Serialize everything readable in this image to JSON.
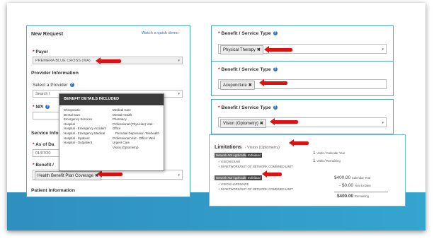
{
  "left_panel": {
    "title": "New Request",
    "demo_link": "Watch a quick demo",
    "payer_label": "Payer",
    "payer_value": "PREMERA BLUE CROSS (WA)",
    "provider_info_heading": "Provider Information",
    "select_provider_label": "Select a Provider",
    "search_placeholder": "Search I",
    "npi_label": "NPI",
    "service_info_heading": "Service Info",
    "as_of_label": "As of Da",
    "date_value": "01/07/20",
    "benefit_label": "Benefit /",
    "benefit_value": "Health Benefit Plan Coverage",
    "patient_info_heading": "Patient Information"
  },
  "popup": {
    "title": "BENEFIT DETAILS INCLUDED",
    "left_items": [
      "Chiropractic",
      "Dental Care",
      "Emergency Services",
      "Hospital",
      "Hospital - Emergency Accident",
      "Hospital - Emergency Medical",
      "Hospital - Inpatient",
      "Hospital - Outpatient"
    ],
    "right_items": [
      "Medical Care",
      "Mental Health",
      "Pharmacy",
      "Professional (Physician) Visit - Office",
      "Perinatal Depression Telehealth",
      "Professional Visit - Office: Well",
      "Urgent Care",
      "Vision (Optometry)"
    ]
  },
  "right_panels": [
    {
      "label": "Benefit / Service Type",
      "tag": "Physical Therapy"
    },
    {
      "label": "Benefit / Service Type",
      "tag": "Acupuncture"
    },
    {
      "label": "Benefit / Service Type",
      "tag": "Vision (Optometry)"
    }
  ],
  "limitations": {
    "title": "Limitations",
    "subtitle": "- Vision (Optometry)",
    "badge_network": "Network Not Applicable",
    "badge_individual": "Individual",
    "row1_item1": "VISION EXAM",
    "row1_item2": "IN-NETWORK/OUT OF NETWORK COMBINED LIMIT",
    "row1_val1": "1",
    "row1_val1_unit": "Visits / Calendar Year",
    "row1_val2": "1",
    "row1_val2_unit": "Visits / Remaining",
    "row2_item1": "VISION HARDWARE",
    "row2_item2": "IN-NETWORK/OUT OF NETWORK COMBINED LIMIT",
    "row2_val1": "$400.00",
    "row2_val1_unit": "Calendar Year",
    "row2_val2": "- $0.00",
    "row2_val2_unit": "Year to Date",
    "row2_val3": "$400.00",
    "row2_val3_unit": "Remaining"
  },
  "accent_color": "#4aa2d0",
  "arrow_color": "#d11111"
}
